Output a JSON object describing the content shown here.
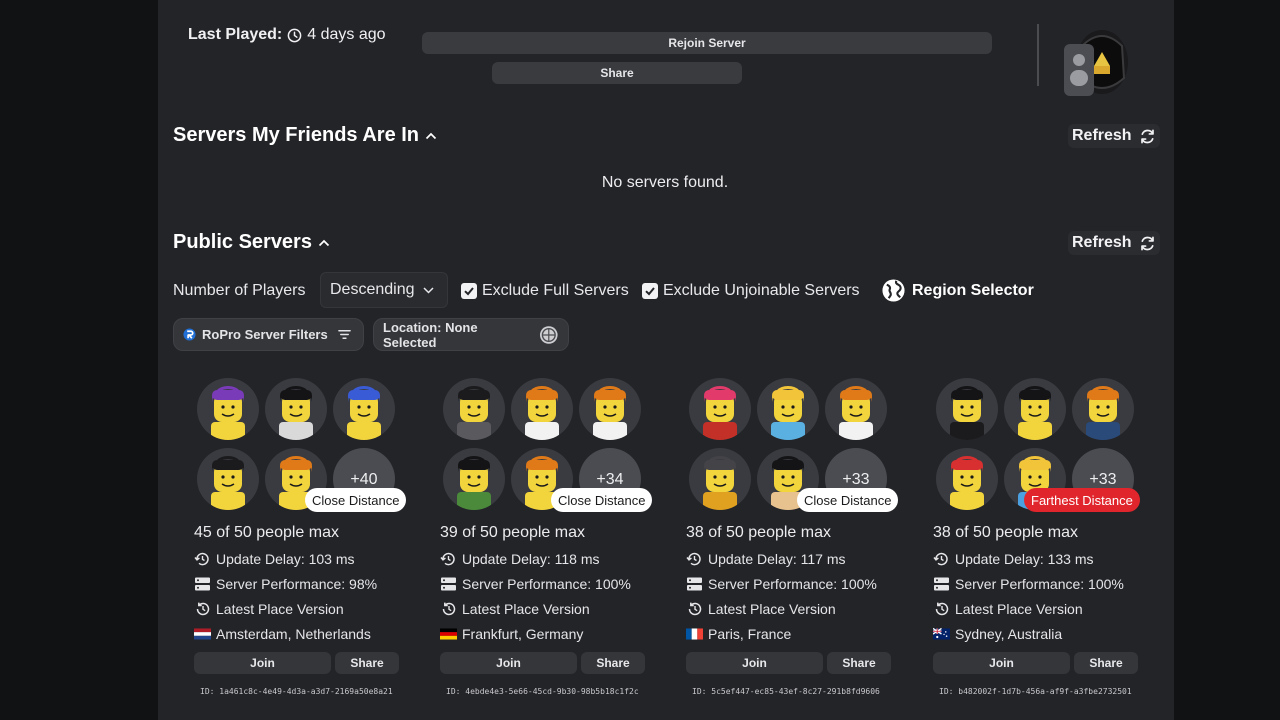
{
  "header": {
    "last_played_label": "Last Played:",
    "last_played_value": "4 days ago",
    "rejoin_label": "Rejoin Server",
    "share_label": "Share"
  },
  "friends": {
    "title": "Servers My Friends Are In",
    "refresh_label": "Refresh",
    "empty_text": "No servers found."
  },
  "public": {
    "title": "Public Servers",
    "refresh_label": "Refresh",
    "filter_label": "Number of Players",
    "sort_value": "Descending",
    "exclude_full": "Exclude Full Servers",
    "exclude_full_checked": true,
    "exclude_unjoinable": "Exclude Unjoinable Servers",
    "exclude_unjoinable_checked": true,
    "region_selector": "Region Selector",
    "ropro_filters": "RoPro Server Filters",
    "location": "Location: None Selected"
  },
  "servers": [
    {
      "more": "+40",
      "distance": "Close Distance",
      "people": "45 of 50 people max",
      "update_delay": "Update Delay: 103 ms",
      "performance": "Server Performance: 98%",
      "version": "Latest Place Version",
      "location": "Amsterdam, Netherlands",
      "flag": "flag-netherlands",
      "join": "Join",
      "share": "Share",
      "id": "ID: 1a461c8c-4e49-4d3a-a3d7-2169a50e8a21"
    },
    {
      "more": "+34",
      "distance": "Close Distance",
      "people": "39 of 50 people max",
      "update_delay": "Update Delay: 118 ms",
      "performance": "Server Performance: 100%",
      "version": "Latest Place Version",
      "location": "Frankfurt, Germany",
      "flag": "flag-germany",
      "join": "Join",
      "share": "Share",
      "id": "ID: 4ebde4e3-5e66-45cd-9b30-98b5b18c1f2c"
    },
    {
      "more": "+33",
      "distance": "Close Distance",
      "people": "38 of 50 people max",
      "update_delay": "Update Delay: 117 ms",
      "performance": "Server Performance: 100%",
      "version": "Latest Place Version",
      "location": "Paris, France",
      "flag": "flag-france",
      "join": "Join",
      "share": "Share",
      "id": "ID: 5c5ef447-ec85-43ef-8c27-291b8fd9606"
    },
    {
      "more": "+33",
      "distance": "Farthest Distance",
      "people": "38 of 50 people max",
      "update_delay": "Update Delay: 133 ms",
      "performance": "Server Performance: 100%",
      "version": "Latest Place Version",
      "location": "Sydney, Australia",
      "flag": "flag-australia",
      "join": "Join",
      "share": "Share",
      "id": "ID: b482002f-1d7b-456a-af9f-a3fbe2732501"
    }
  ],
  "colors": {
    "background": "#111214",
    "panel": "#232428",
    "button": "#34363a",
    "close_badge": "#ffffff",
    "far_badge": "#e0262c"
  }
}
